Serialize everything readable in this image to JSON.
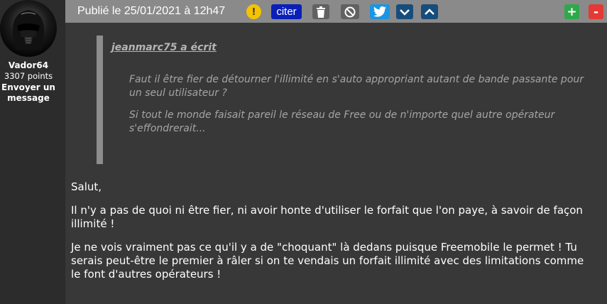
{
  "user": {
    "username": "Vador64",
    "points": "3307 points",
    "send_message": "Envoyer un message",
    "avatar": "darth-vader-avatar"
  },
  "header": {
    "published": "Publié le 25/01/2021 à 12h47",
    "alert_label": "!",
    "quote_label": "citer",
    "plus_label": "+",
    "minus_label": "-",
    "icons": [
      "alert-icon",
      "trash-icon",
      "block-icon",
      "twitter-icon",
      "chevron-down-icon",
      "chevron-up-icon"
    ]
  },
  "quote": {
    "author": "jeanmarc75 a écrit",
    "paragraphs": [
      "Faut il être fier de détourner l'illimité en s'auto appropriant autant de bande passante pour un seul utilisateur ?",
      "Si tout le monde faisait pareil le réseau de Free ou de n'importe quel autre opérateur s'effondrerait..."
    ]
  },
  "message": {
    "paragraphs": [
      "Salut,",
      "Il n'y a pas de quoi ni être fier, ni avoir honte d'utiliser le forfait que l'on paye, à savoir de façon illimité !",
      "Je ne vois vraiment pas ce qu'il y a de \"choquant\" là dedans puisque Freemobile le permet ! Tu serais peut-être le premier à râler si on te vendais un forfait illimité avec des limitations comme le font d'autres opérateurs !"
    ]
  },
  "colors": {
    "background": "#383838",
    "header": "#8a8a8a",
    "quote_button": "#0a1fb8",
    "twitter": "#1d95e0",
    "nav_buttons": "#174d7a",
    "plus": "#2fa84a",
    "minus": "#e53935",
    "alert": "#f5c400"
  }
}
